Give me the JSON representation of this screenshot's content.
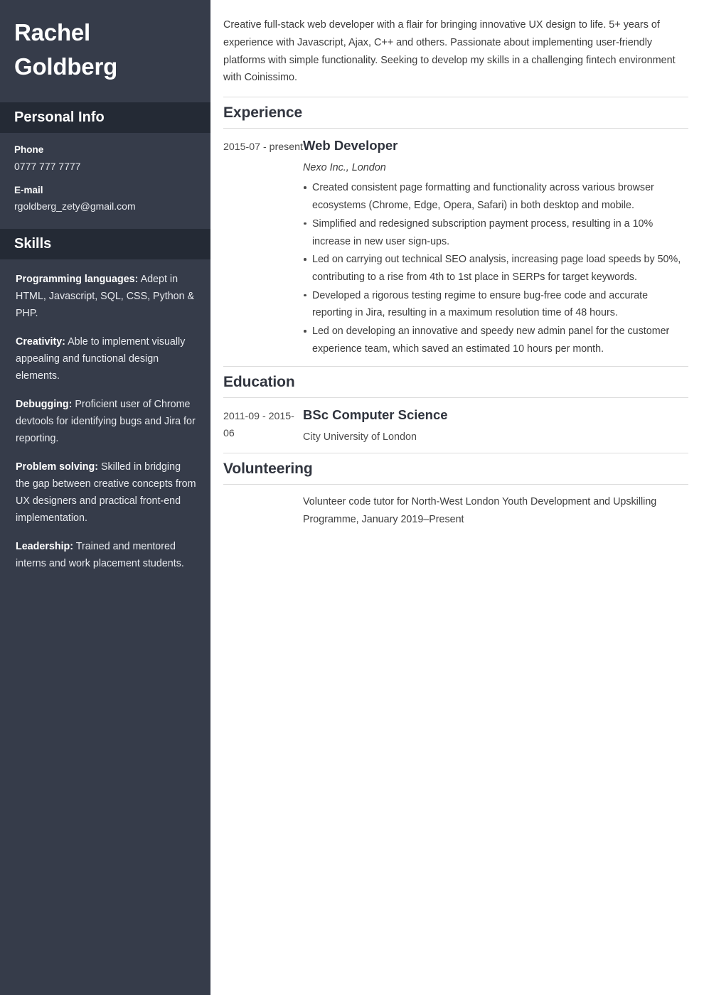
{
  "sidebar": {
    "name": "Rachel Goldberg",
    "personal_info": {
      "heading": "Personal Info",
      "items": [
        {
          "label": "Phone",
          "value": "0777 777 7777"
        },
        {
          "label": "E-mail",
          "value": "rgoldberg_zety@gmail.com"
        }
      ]
    },
    "skills": {
      "heading": "Skills",
      "items": [
        {
          "name": "Programming languages:",
          "description": " Adept in HTML, Javascript, SQL, CSS, Python & PHP."
        },
        {
          "name": "Creativity:",
          "description": " Able to implement visually appealing and functional design elements."
        },
        {
          "name": "Debugging:",
          "description": " Proficient user of Chrome devtools for identifying bugs and Jira for reporting."
        },
        {
          "name": "Problem solving:",
          "description": " Skilled in bridging the gap between creative concepts from UX designers and practical front-end implementation."
        },
        {
          "name": "Leadership:",
          "description": " Trained and mentored interns and work placement students."
        }
      ]
    }
  },
  "main": {
    "summary": "Creative full-stack web developer with a flair for bringing innovative UX design to life. 5+ years of experience with Javascript, Ajax, C++ and others. Passionate about implementing user-friendly platforms with simple functionality. Seeking to develop my skills in a challenging fintech environment with Coinissimo.",
    "experience": {
      "heading": "Experience",
      "entries": [
        {
          "dates": "2015-07 - present",
          "title": "Web Developer",
          "subtitle": "Nexo Inc., London",
          "bullets": [
            "Created consistent page formatting and functionality across various browser ecosystems (Chrome, Edge, Opera, Safari) in both desktop and mobile.",
            "Simplified and redesigned subscription payment process, resulting in a 10% increase in new user sign-ups.",
            "Led on carrying out technical SEO analysis, increasing page load speeds by 50%, contributing to a rise from 4th to 1st place in SERPs for target keywords.",
            "Developed a rigorous testing regime to ensure bug-free code and accurate reporting in Jira, resulting in a maximum resolution time of 48 hours.",
            "Led on developing an innovative and speedy new admin panel for the customer experience team, which saved an estimated 10 hours per month."
          ]
        }
      ]
    },
    "education": {
      "heading": "Education",
      "entries": [
        {
          "dates": "2011-09 - 2015-06",
          "title": "BSc Computer Science",
          "subtitle": "City University of London"
        }
      ]
    },
    "volunteering": {
      "heading": "Volunteering",
      "dates": "",
      "text": "Volunteer code tutor for North-West London Youth Development and Upskilling Programme, January 2019–Present"
    }
  },
  "colors": {
    "sidebar_bg": "#363c4a",
    "sidebar_header_bg": "#242a35",
    "main_bg": "#ffffff",
    "heading_text": "#31353f",
    "body_text": "#3c3c3c",
    "rule": "#dcdcdc"
  }
}
